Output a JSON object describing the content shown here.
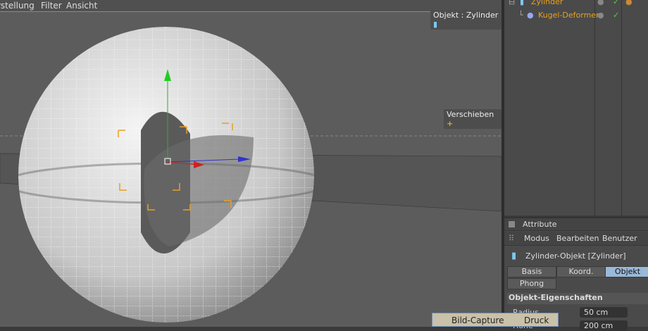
{
  "menu": [
    "rstellung",
    "Filter",
    "Ansicht"
  ],
  "viewport": {
    "object_label": "Objekt : Zylinder",
    "tool_label": "Verschieben"
  },
  "object_manager": {
    "items": [
      {
        "name": "Zylinder",
        "icon": "cylinder-icon"
      },
      {
        "name": "Kugel-Deformer",
        "icon": "sphere-icon"
      }
    ]
  },
  "attributes": {
    "title": "Attribute",
    "menu": [
      "Modus",
      "Bearbeiten",
      "Benutzer"
    ],
    "object_title": "Zylinder-Objekt [Zylinder]",
    "tabs": [
      "Basis",
      "Koord.",
      "Objekt",
      "Phong"
    ],
    "active_tab": "Objekt",
    "section": "Objekt-Eigenschaften",
    "fields": [
      {
        "label": "Radius",
        "value": "50 cm"
      },
      {
        "label": "Höhe",
        "value": "200 cm"
      }
    ]
  },
  "popup": {
    "items": [
      "Bild-Capture",
      "Druck"
    ]
  },
  "colors": {
    "accent": "#e8a020",
    "active_tab": "#9ab8d8"
  }
}
